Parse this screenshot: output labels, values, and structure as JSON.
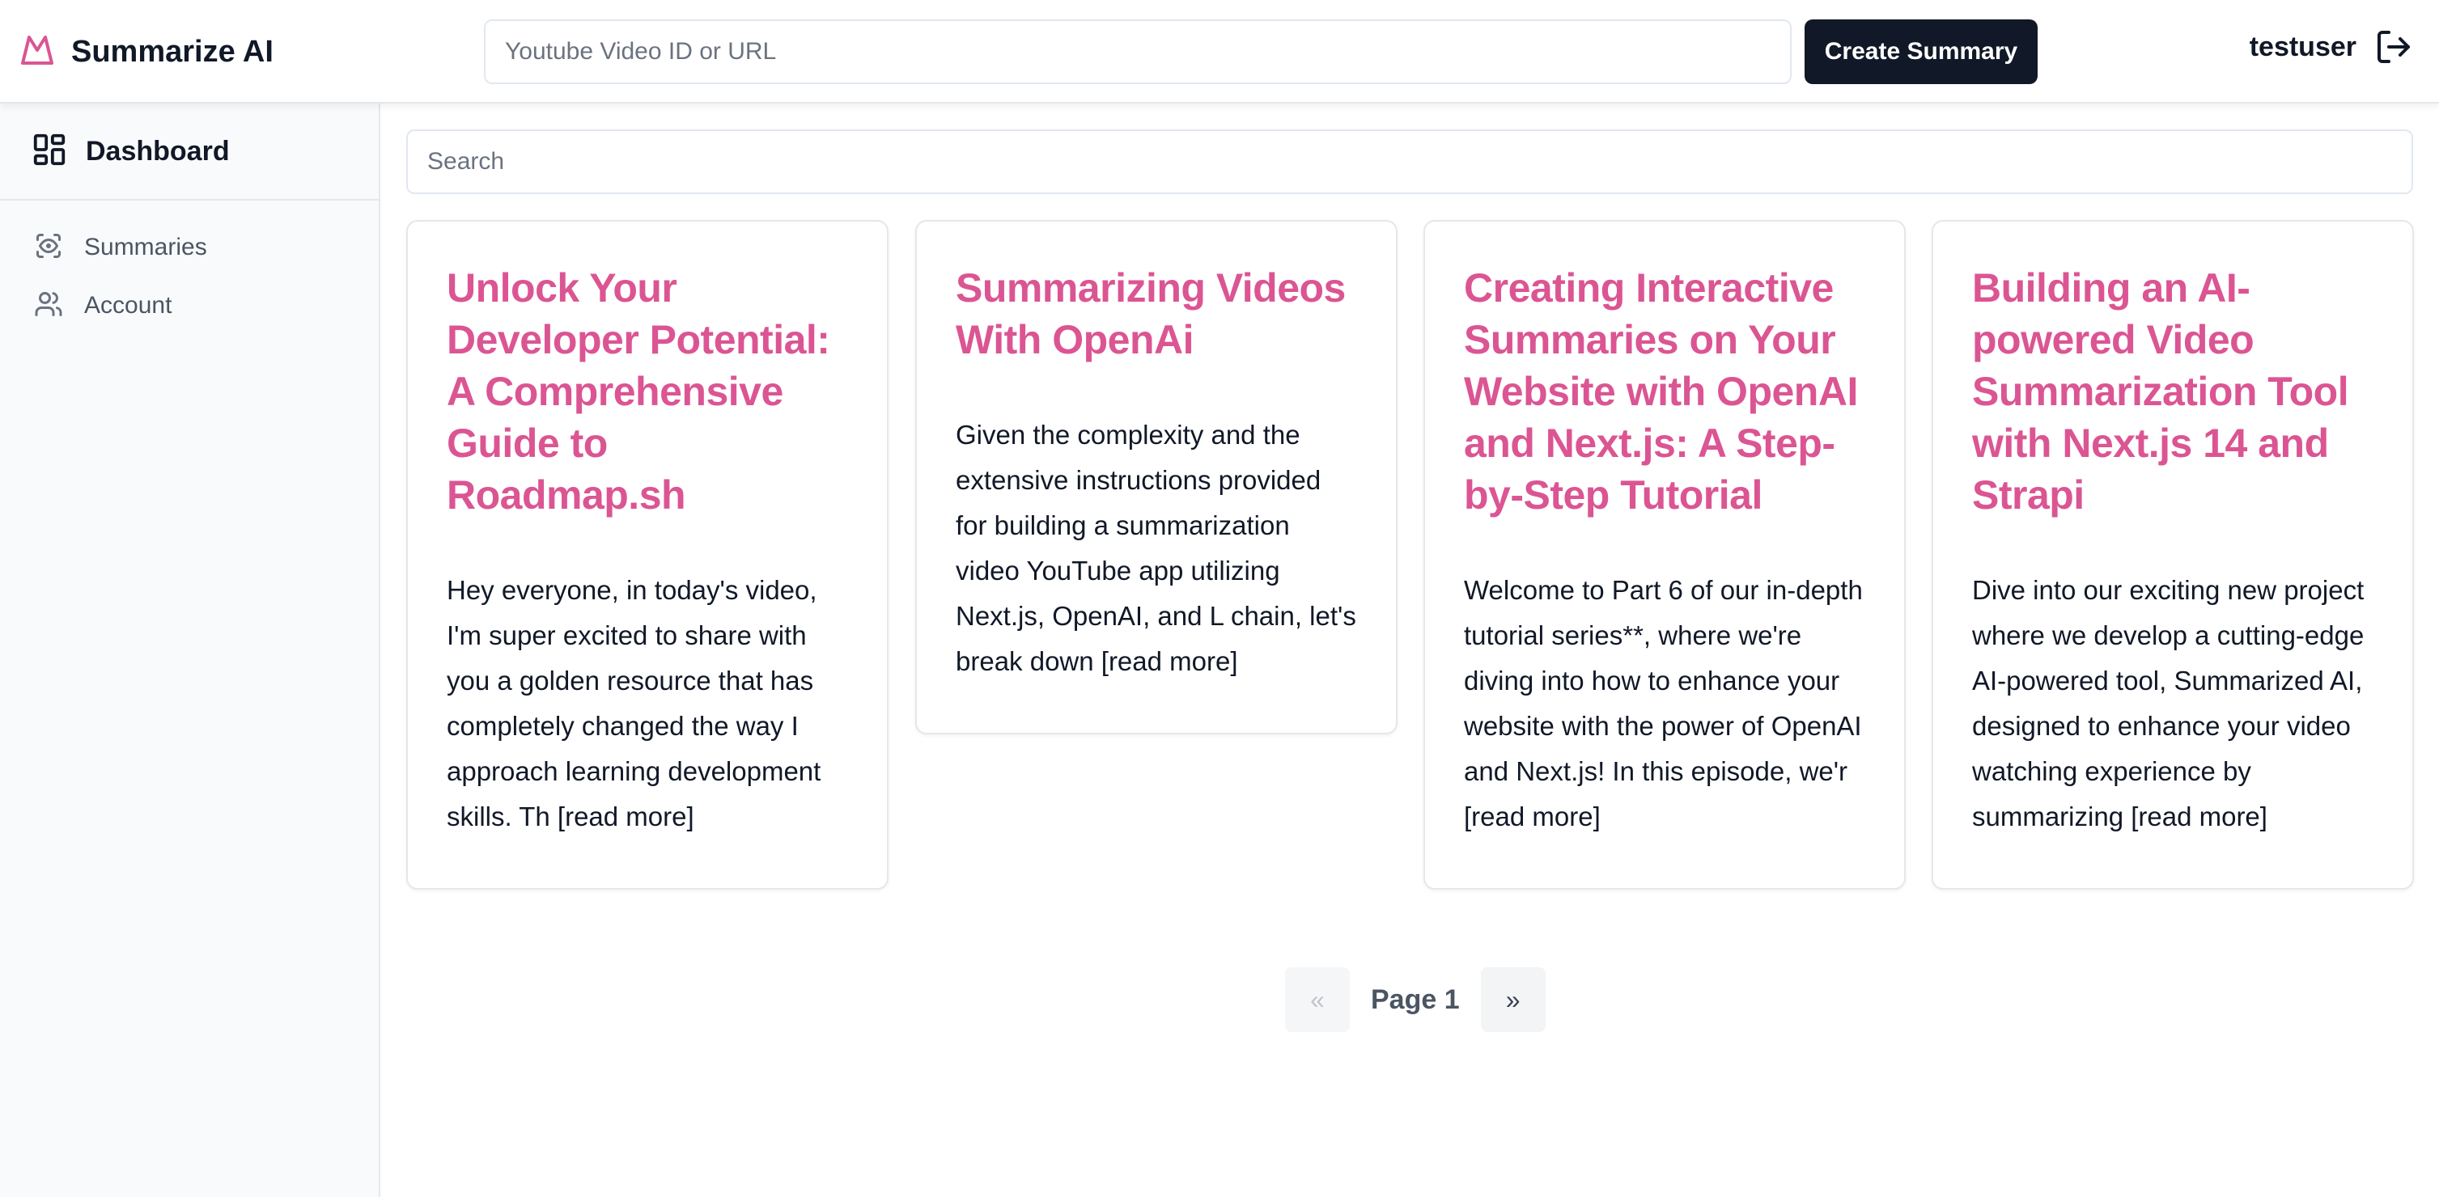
{
  "header": {
    "brand_name": "Summarize AI",
    "url_placeholder": "Youtube Video ID or URL",
    "create_button": "Create Summary",
    "username": "testuser"
  },
  "sidebar": {
    "title": "Dashboard",
    "items": [
      {
        "label": "Summaries",
        "icon": "eye-icon"
      },
      {
        "label": "Account",
        "icon": "users-icon"
      }
    ]
  },
  "main": {
    "search_placeholder": "Search",
    "cards": [
      {
        "title": "Unlock Your Developer Potential: A Comprehensive Guide to Roadmap.sh",
        "description": "Hey everyone, in today's video, I'm super excited to share with you a golden resource that has completely changed the way I approach learning development skills. Th [read more]"
      },
      {
        "title": "Summarizing Videos With OpenAi",
        "description": "Given the complexity and the extensive instructions provided for building a summarization video YouTube app utilizing Next.js, OpenAI, and L chain, let's break down [read more]"
      },
      {
        "title": "Creating Interactive Summaries on Your Website with OpenAI and Next.js: A Step-by-Step Tutorial",
        "description": "Welcome to Part 6 of our in-depth tutorial series**, where we're diving into how to enhance your website with the power of OpenAI and Next.js! In this episode, we'r [read more]"
      },
      {
        "title": "Building an AI-powered Video Summarization Tool with Next.js 14 and Strapi",
        "description": "Dive into our exciting new project where we develop a cutting-edge AI-powered tool, Summarized AI, designed to enhance your video watching experience by summarizing [read more]"
      }
    ]
  },
  "pagination": {
    "prev": "«",
    "label": "Page 1",
    "next": "»"
  },
  "colors": {
    "accent": "#db5593",
    "button_dark": "#111827"
  }
}
